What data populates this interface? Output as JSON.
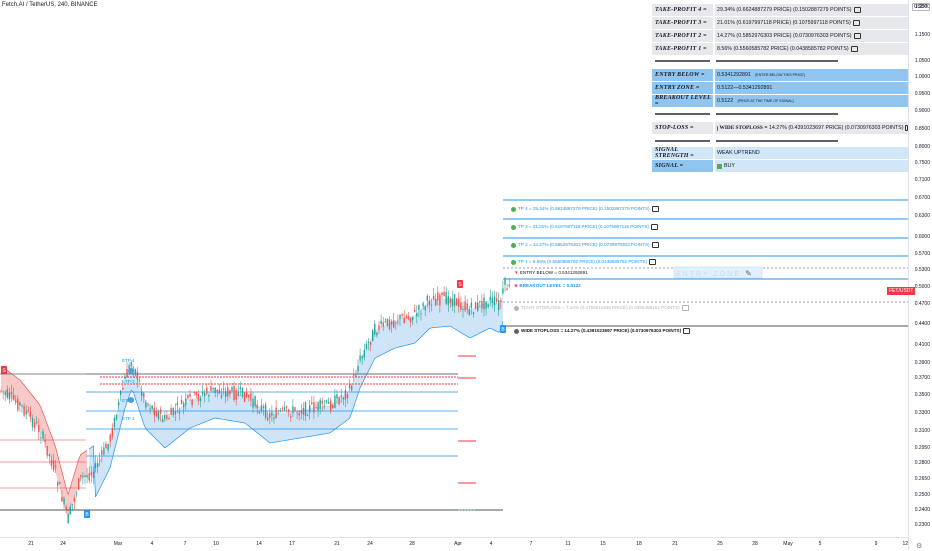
{
  "legend": {
    "symbol": "Fetch.AI / TetherUS, 240, BINANCE"
  },
  "y_axis": {
    "currency": "USDT",
    "ticks": [
      "1.2500",
      "1.1500",
      "1.0500",
      "1.0000",
      "0.9500",
      "0.9000",
      "0.8500",
      "0.8000",
      "0.7500",
      "0.7100",
      "0.6700",
      "0.6300",
      "0.6000",
      "0.5700",
      "0.5300",
      "0.5000",
      "0.4700",
      "0.4400",
      "0.4100",
      "0.3900",
      "0.3700",
      "0.3500",
      "0.3300",
      "0.3100",
      "0.2950",
      "0.2800",
      "0.2650",
      "0.2500",
      "0.2400",
      "0.2300"
    ],
    "last_price": "FET/USDT"
  },
  "x_axis": {
    "ticks": [
      "21",
      "24",
      "Mar",
      "4",
      "7",
      "10",
      "14",
      "17",
      "21",
      "24",
      "28",
      "Apr",
      "4",
      "7",
      "11",
      "15",
      "18",
      "21",
      "25",
      "28",
      "May",
      "5",
      "9",
      "12"
    ]
  },
  "table": {
    "tp4": {
      "label": "TAKE-PROFIT 4 =",
      "value": "29.34% (0.6624887279 PRICE) (0.1502887279 POINTS)"
    },
    "tp3": {
      "label": "TAKE-PROFIT 3 =",
      "value": "21.01% (0.6197997118 PRICE) (0.1075997118 POINTS)"
    },
    "tp2": {
      "label": "TAKE-PROFIT 2 =",
      "value": "14.27% (0.5852976303 PRICE) (0.0730976303 POINTS)"
    },
    "tp1": {
      "label": "TAKE-PROFIT 1 =",
      "value": "8.56% (0.5560585782 PRICE) (0.0438585782 POINTS)"
    },
    "entry_below": {
      "label": "ENTRY BELOW =",
      "value": "0.5341292891",
      "note": "[ENTER BELOW THIS PRICE]"
    },
    "entry_zone": {
      "label": "ENTRY ZONE =",
      "value": "0.5122—0.5341292891"
    },
    "breakout": {
      "label": "BREAKOUT LEVEL =",
      "value": "0.5122",
      "note": "[PRICE AT THE TIME OF SIGNAL]"
    },
    "stoploss": {
      "label": "STOP-LOSS =",
      "name": "WIDE STOPLOSS",
      "value": "= 14.27% (0.4391023697 PRICE) (0.0730976303 POINTS)"
    },
    "strength": {
      "label": "SIGNAL STRENGTH =",
      "value": "WEAK UPTREND"
    },
    "signal": {
      "label": "SIGNAL =",
      "value": "BUY"
    }
  },
  "levels": {
    "tp4": "TP 4 = 29.34% (0.6624887279 PRICE) (0.1502887279 POINTS)",
    "tp3": "TP 3 = 21.01% (0.6197997118 PRICE) (0.1075997118 POINTS)",
    "tp2": "TP 2 = 14.27% (0.5852976303 PRICE) (0.0730976303 POINTS)",
    "tp1": "TP 1 = 8.56% (0.5560585782 PRICE) (0.0438585782 POINTS)",
    "entry": "ENTRY BELOW = 0.5341292891",
    "breakout": "BREAKOUT LEVEL = 0.5122",
    "tight": "TIGHT STOPLOSS = 7.14% (0.4756511848 PRICE) (0.0365488152 POINTS)",
    "wide": "WIDE STOPLOSS = 14.27% (0.4391023697 PRICE) (0.0730976303 POINTS)",
    "entry_zone_box": "ENTRY ZONE",
    "markers": {
      "s": "S",
      "b": "B"
    }
  },
  "left_labels": [
    "ETP 4",
    "ETP 3",
    "ETP 2",
    "ETP 1"
  ],
  "colors": {
    "tp": "#4caf50",
    "bg": "#ffffff",
    "up": "#26a69a",
    "down": "#ef5350",
    "cloud_up": "#cfe4f7",
    "cloud_down": "#f7c9c9",
    "line_blue": "#2196f3"
  }
}
